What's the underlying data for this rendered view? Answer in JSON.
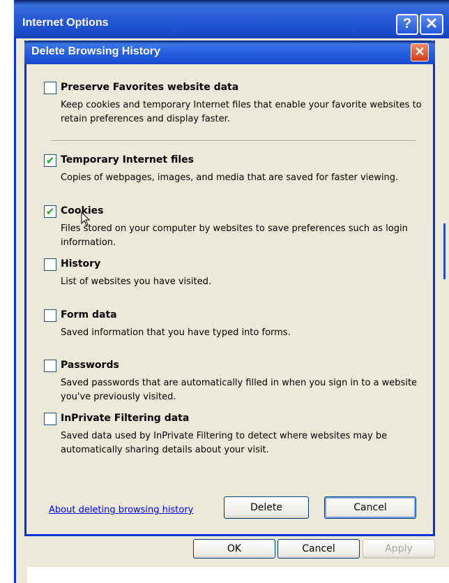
{
  "outer_window": {
    "title": "Internet Options",
    "help_label": "?",
    "close_label": "✕",
    "buttons": {
      "ok": "OK",
      "cancel": "Cancel",
      "apply": "Apply"
    }
  },
  "dialog": {
    "title": "Delete Browsing History",
    "close_label": "✕",
    "options": [
      {
        "title": "Preserve Favorites website data",
        "checked": false,
        "desc": "Keep cookies and temporary Internet files that enable your favorite websites to retain preferences and display faster."
      },
      {
        "title": "Temporary Internet files",
        "checked": true,
        "desc": "Copies of webpages, images, and media that are saved for faster viewing."
      },
      {
        "title": "Cookies",
        "checked": true,
        "desc": "Files stored on your computer by websites to save preferences such as login information."
      },
      {
        "title": "History",
        "checked": false,
        "desc": "List of websites you have visited."
      },
      {
        "title": "Form data",
        "checked": false,
        "desc": "Saved information that you have typed into forms."
      },
      {
        "title": "Passwords",
        "checked": false,
        "desc": "Saved passwords that are automatically filled in when you sign in to a website you've previously visited."
      },
      {
        "title": "InPrivate Filtering data",
        "checked": false,
        "desc": "Saved data used by InPrivate Filtering to detect where websites may be automatically sharing details about your visit."
      }
    ],
    "about_link": "About deleting browsing history",
    "delete_label": "Delete",
    "cancel_label": "Cancel"
  },
  "colors": {
    "titlebar": "#2A5BD7",
    "dialog_bg": "#ECE9D8",
    "close_red": "#D23C14",
    "check_green": "#21A121",
    "link_blue": "#0000FF"
  },
  "icons": {
    "checkmark": "check-mark-icon",
    "cursor": "mouse-pointer-icon"
  }
}
